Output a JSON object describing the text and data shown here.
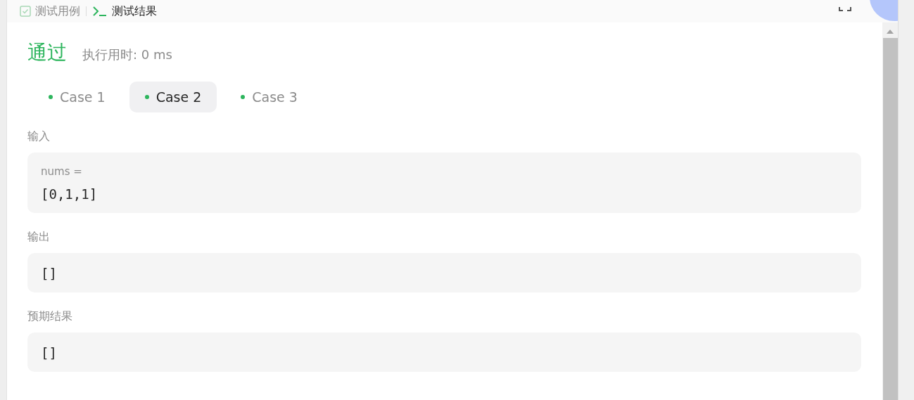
{
  "header_tabs": [
    {
      "label": "测试用例",
      "selected": false
    },
    {
      "label": "测试结果",
      "selected": true
    }
  ],
  "result": {
    "status": "通过",
    "passed": true,
    "runtime": "执行用时: 0 ms"
  },
  "cases": [
    {
      "label": "Case 1",
      "selected": false
    },
    {
      "label": "Case 2",
      "selected": true
    },
    {
      "label": "Case 3",
      "selected": false
    }
  ],
  "sections": [
    {
      "title": "输入",
      "var_name": "nums =",
      "value": "[0,1,1]"
    },
    {
      "title": "输出",
      "value": "[]"
    },
    {
      "title": "预期结果",
      "value": "[]"
    }
  ]
}
